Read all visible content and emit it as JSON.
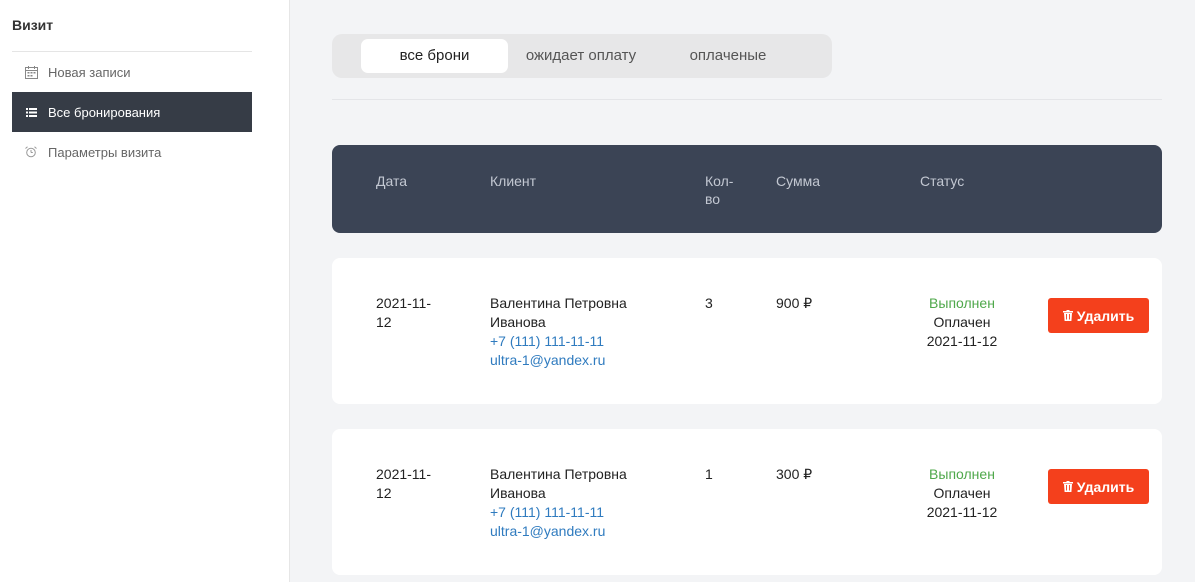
{
  "sidebar": {
    "title": "Визит",
    "items": [
      {
        "label": "Новая записи",
        "icon": "calendar-icon"
      },
      {
        "label": "Все бронирования",
        "icon": "list-icon"
      },
      {
        "label": "Параметры визита",
        "icon": "alarm-clock-icon"
      }
    ]
  },
  "tabs": [
    {
      "label": "все брони"
    },
    {
      "label": "ожидает оплату"
    },
    {
      "label": "оплаченые"
    }
  ],
  "table": {
    "headers": {
      "date": "Дата",
      "client": "Клиент",
      "qty": "Кол-во",
      "sum": "Сумма",
      "status": "Статус"
    },
    "rows": [
      {
        "date": "2021-11-12",
        "client_name": "Валентина Петровна Иванова",
        "phone": "+7 (111) 111-11-11",
        "email": "ultra-1@yandex.ru",
        "qty": "3",
        "sum": "900 ₽",
        "status": "Выполнен",
        "payment": "Оплачен",
        "payment_date": "2021-11-12",
        "delete_label": "Удалить"
      },
      {
        "date": "2021-11-12",
        "client_name": "Валентина Петровна Иванова",
        "phone": "+7 (111) 111-11-11",
        "email": "ultra-1@yandex.ru",
        "qty": "1",
        "sum": "300 ₽",
        "status": "Выполнен",
        "payment": "Оплачен",
        "payment_date": "2021-11-12",
        "delete_label": "Удалить"
      }
    ]
  },
  "colors": {
    "sidebar_active": "#363c46",
    "table_header": "#3b4455",
    "status_done": "#4fa84b",
    "link": "#2f7bbf",
    "delete_button": "#f4401c"
  }
}
